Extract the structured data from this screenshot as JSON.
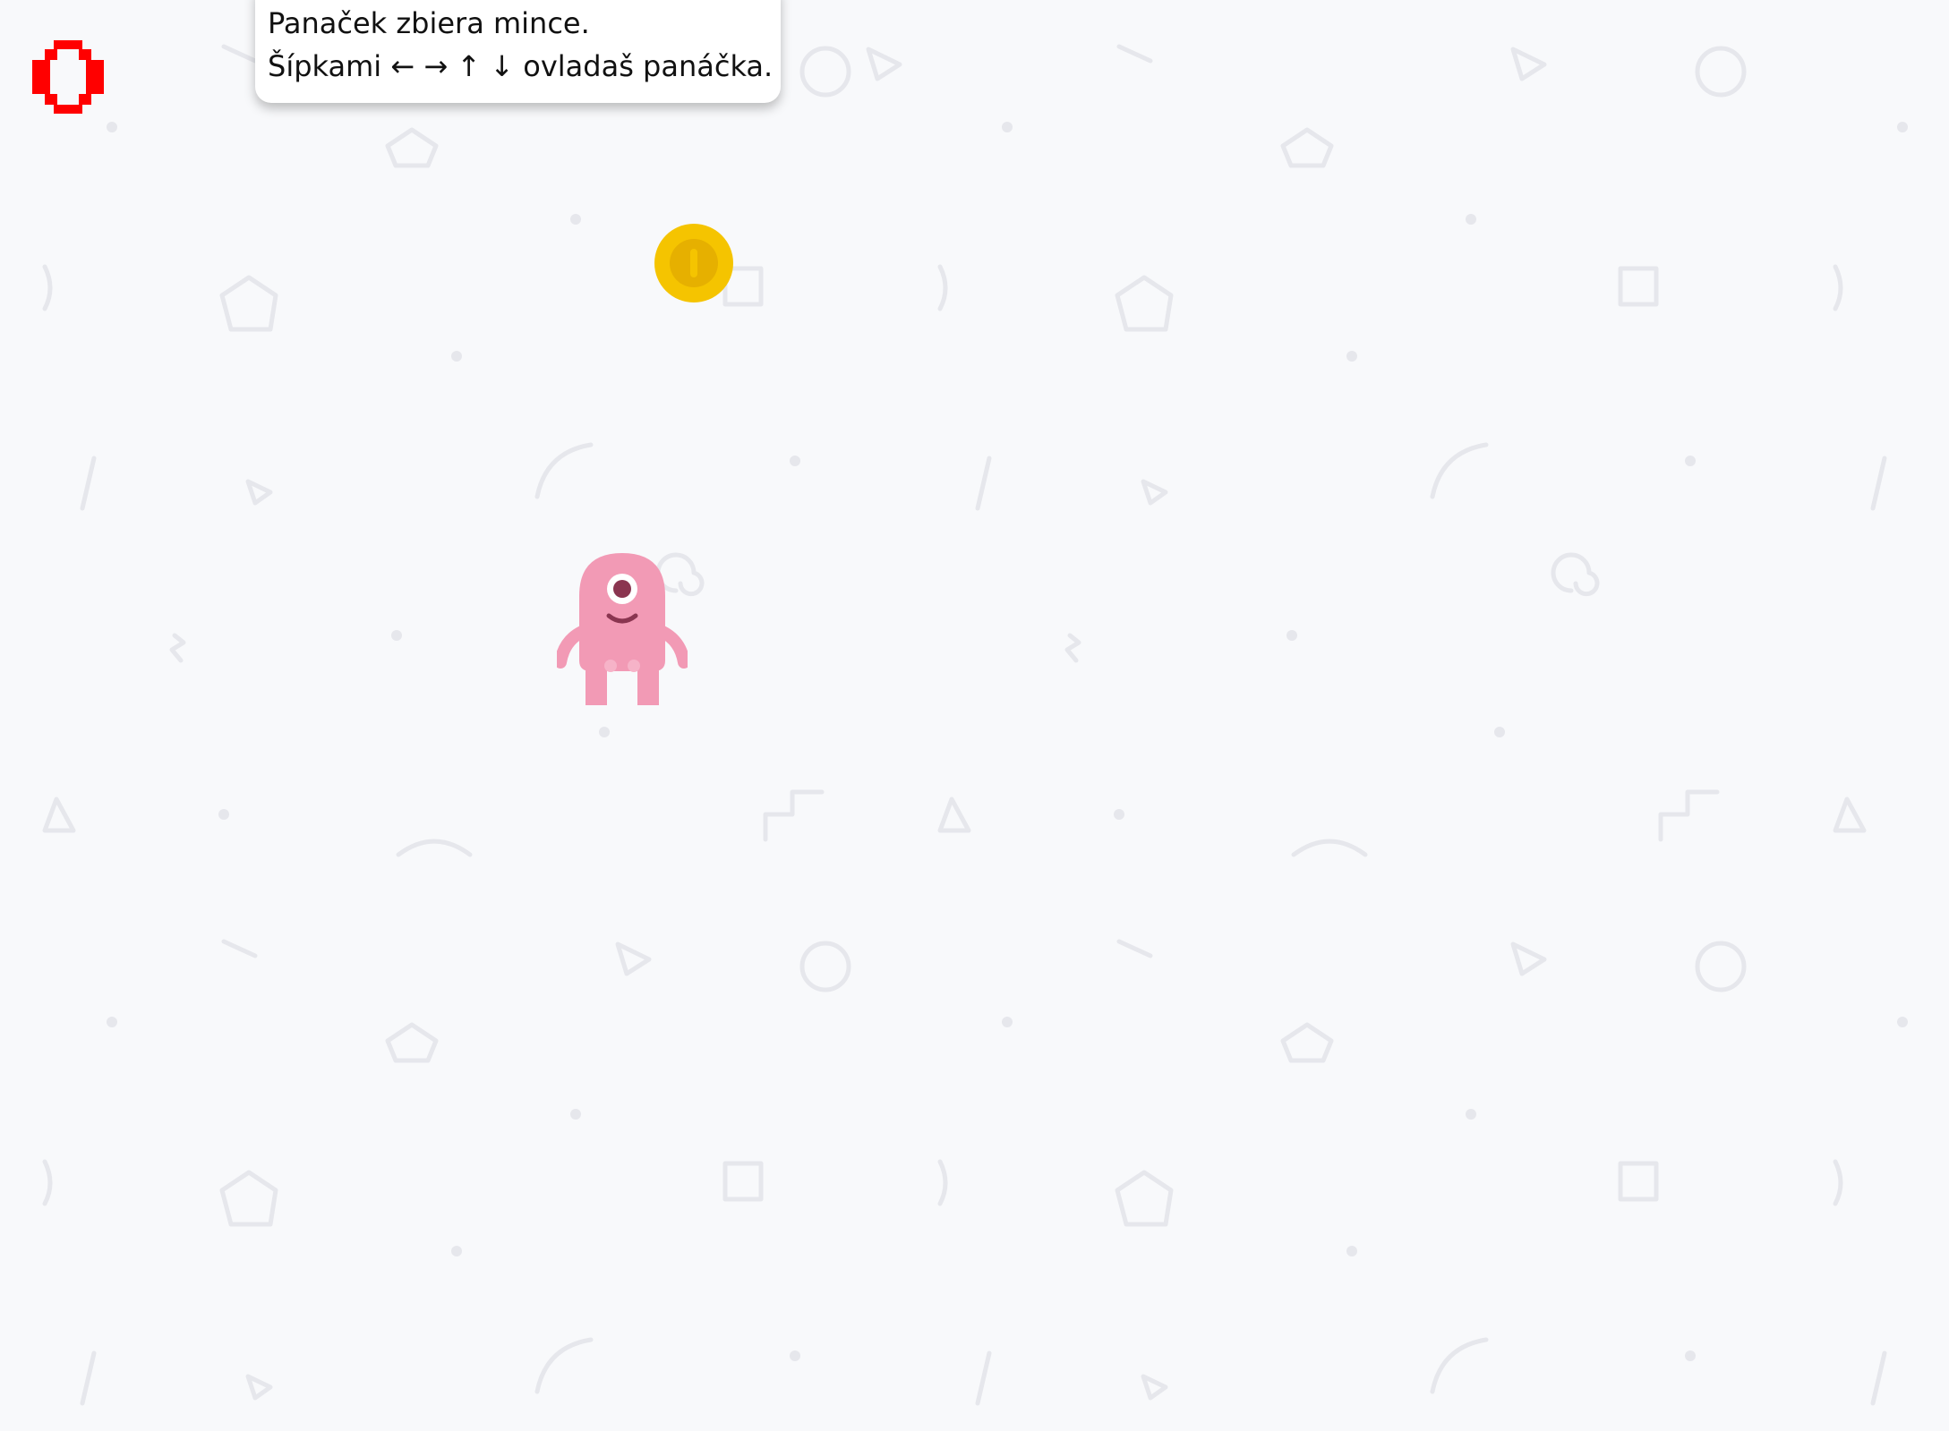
{
  "game": {
    "instructions": {
      "line1": "Panaček zbiera mince.",
      "line2": "Šípkami ← → ↑ ↓ ovladaš panáčka."
    },
    "score": {
      "value": "0",
      "color": "#ff0000"
    },
    "coin": {
      "icon": "coin-icon",
      "color": "#f5c400"
    },
    "player": {
      "icon": "pink-one-eyed-monster",
      "color": "#f29ab5"
    },
    "background": {
      "color": "#f8f9fb",
      "pattern_color": "#e6e7ec"
    }
  }
}
